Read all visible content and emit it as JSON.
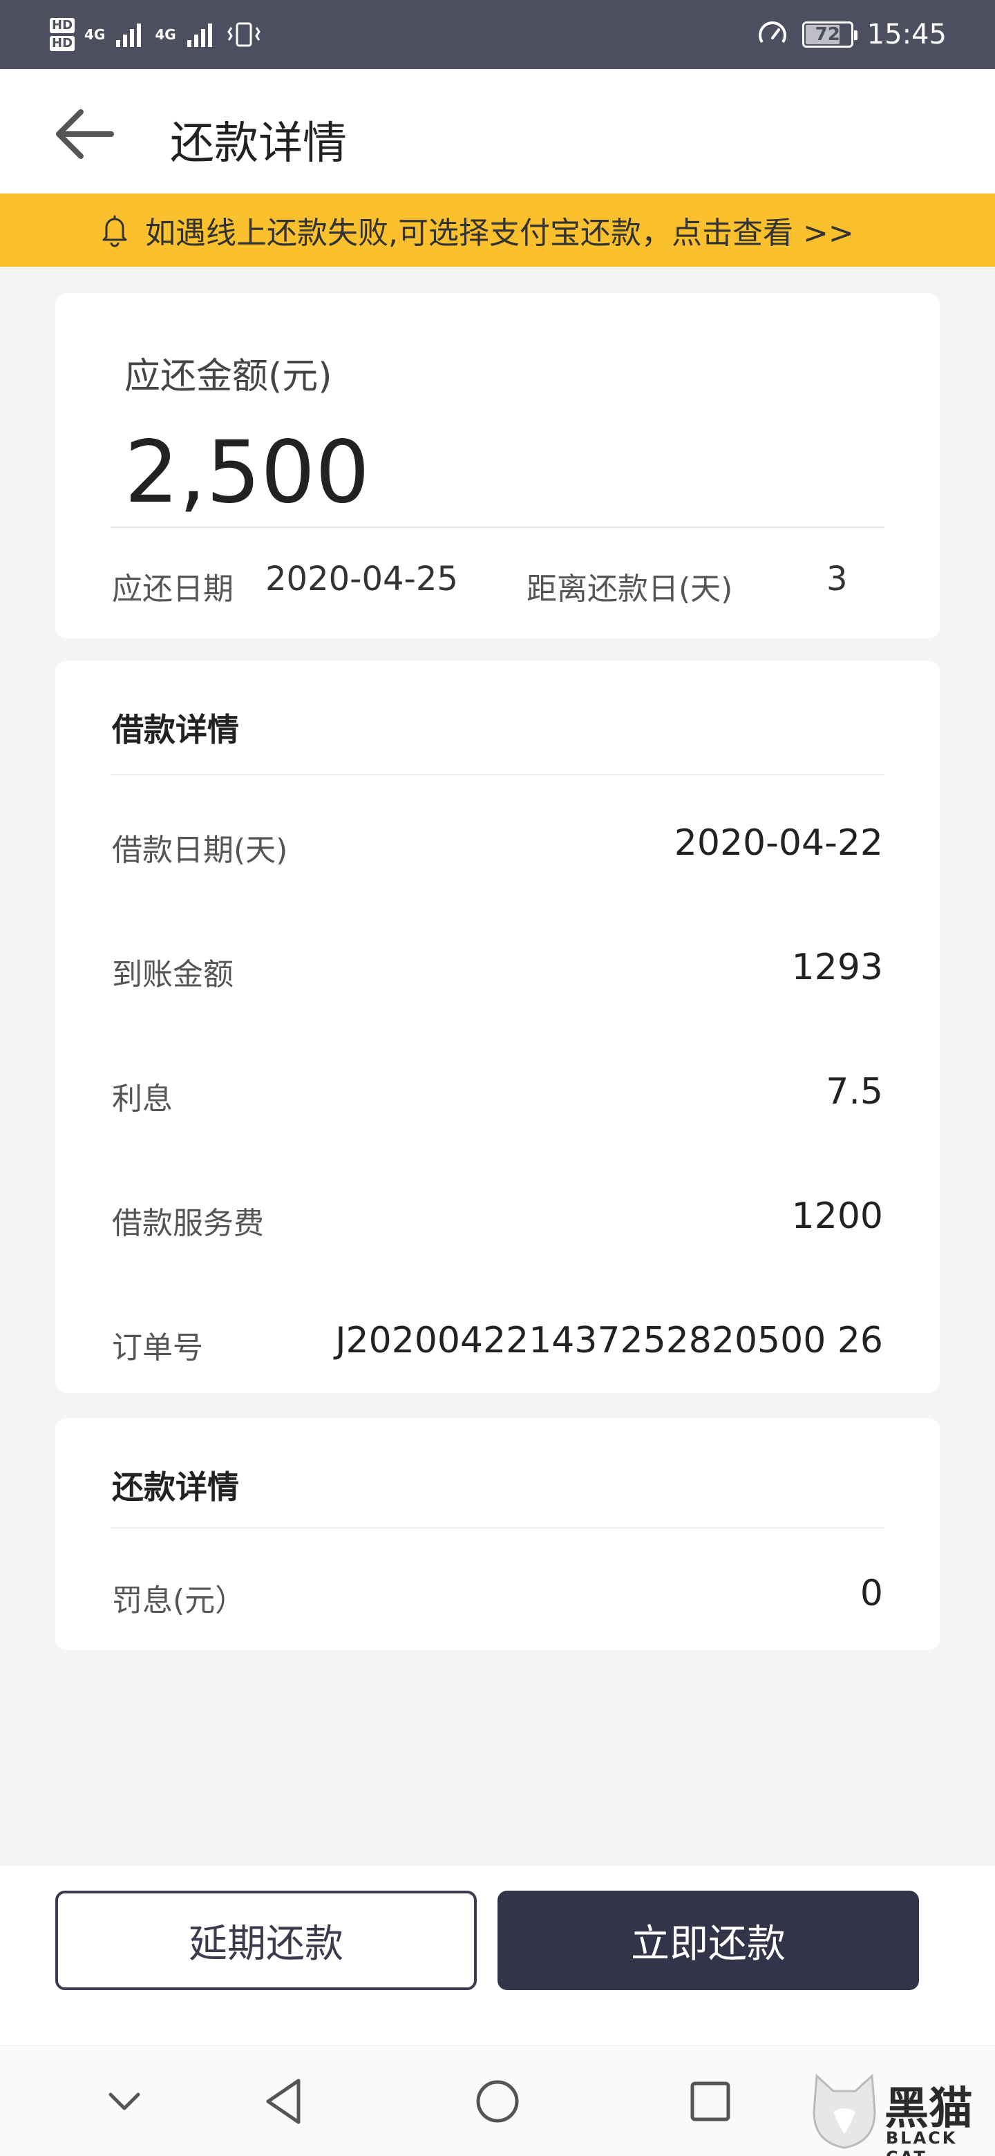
{
  "status_bar": {
    "hd1": "HD",
    "hd2": "HD",
    "net1": "4G",
    "net2": "4G",
    "battery": "72",
    "time": "15:45"
  },
  "header": {
    "title": "还款详情"
  },
  "notice": {
    "text": "如遇线上还款失败,可选择支付宝还款，点击查看 >>"
  },
  "amount_card": {
    "label": "应还金额(元)",
    "value": "2,500",
    "due_date_label": "应还日期",
    "due_date_value": "2020-04-25",
    "days_left_label": "距离还款日(天)",
    "days_left_value": "3"
  },
  "loan_card": {
    "title": "借款详情",
    "rows": [
      {
        "label": "借款日期(天)",
        "value": "2020-04-22"
      },
      {
        "label": "到账金额",
        "value": "1293"
      },
      {
        "label": "利息",
        "value": "7.5"
      },
      {
        "label": "借款服务费",
        "value": "1200"
      },
      {
        "label": "订单号",
        "value": "J202004221437252820500 26"
      }
    ]
  },
  "repay_card": {
    "title": "还款详情",
    "rows": [
      {
        "label": "罚息(元）",
        "value": "0"
      }
    ]
  },
  "actions": {
    "delay_label": "延期还款",
    "pay_label": "立即还款"
  },
  "watermark": {
    "brand": "黑猫",
    "sub": "BLACK CAT"
  },
  "colors": {
    "status_bar": "#4d4f60",
    "notice_bg": "#fbc02d",
    "primary_button": "#33344a"
  }
}
